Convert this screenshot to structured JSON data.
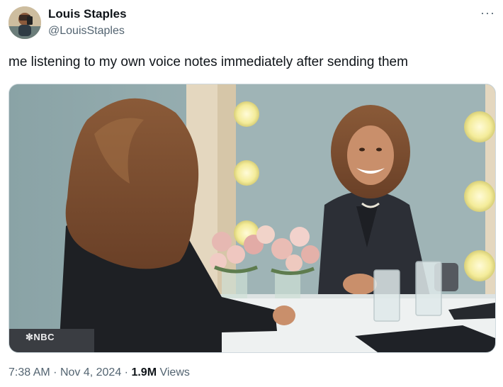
{
  "author": {
    "display_name": "Louis Staples",
    "handle": "@LouisStaples",
    "avatar_icon": "user-avatar-photo"
  },
  "more_icon": "more-options-icon",
  "tweet": {
    "text": "me listening to my own voice notes immediately after sending them"
  },
  "media": {
    "watermark": "NBC",
    "watermark_icon": "nbc-peacock-icon"
  },
  "meta": {
    "time": "7:38 AM",
    "separator": "·",
    "date": "Nov 4, 2024",
    "views_count": "1.9M",
    "views_label": "Views"
  },
  "colors": {
    "text_primary": "#0f1419",
    "text_secondary": "#536471",
    "border": "#cfd9de"
  }
}
